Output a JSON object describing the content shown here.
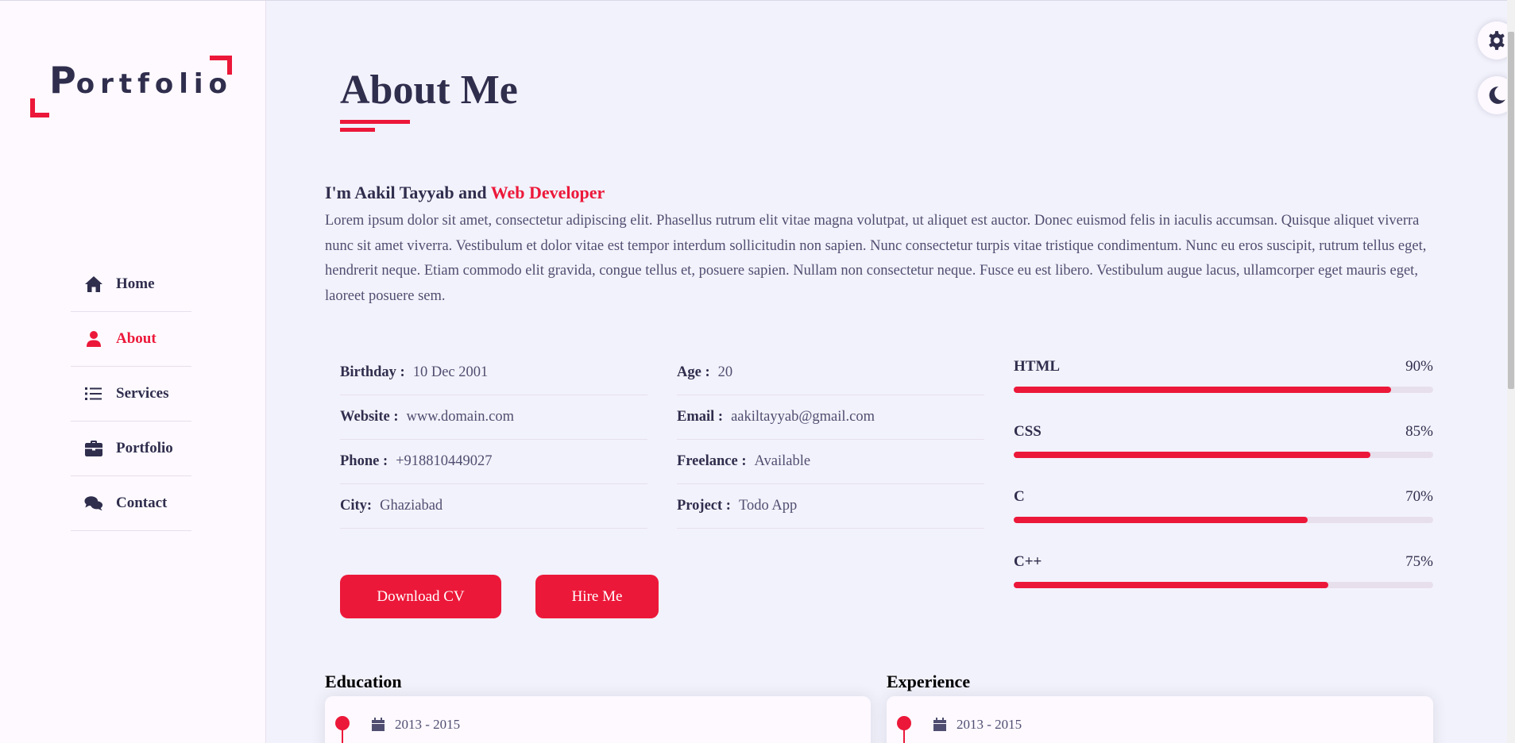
{
  "logo": {
    "first_letter": "P",
    "rest": "ortfolio"
  },
  "nav": {
    "items": [
      {
        "label": "Home",
        "icon": "home-icon",
        "active": false
      },
      {
        "label": "About",
        "icon": "user-icon",
        "active": true
      },
      {
        "label": "Services",
        "icon": "list-icon",
        "active": false
      },
      {
        "label": "Portfolio",
        "icon": "briefcase-icon",
        "active": false
      },
      {
        "label": "Contact",
        "icon": "comments-icon",
        "active": false
      }
    ]
  },
  "about": {
    "title": "About Me",
    "intro_prefix": "I'm Aakil Tayyab and ",
    "intro_role": "Web Developer",
    "intro_text": "Lorem ipsum dolor sit amet, consectetur adipiscing elit. Phasellus rutrum elit vitae magna volutpat, ut aliquet est auctor. Donec euismod felis in iaculis accumsan. Quisque aliquet viverra nunc sit amet viverra. Vestibulum et dolor vitae est tempor interdum sollicitudin non sapien. Nunc consectetur turpis vitae tristique condimentum. Nunc eu eros suscipit, rutrum tellus eget, hendrerit neque. Etiam commodo elit gravida, congue tellus et, posuere sapien. Nullam non consectetur neque. Fusce eu est libero. Vestibulum augue lacus, ullamcorper eget mauris eget, laoreet posuere sem.",
    "info_left": [
      {
        "key": "Birthday :",
        "value": "10 Dec 2001"
      },
      {
        "key": "Website :",
        "value": "www.domain.com"
      },
      {
        "key": "Phone :",
        "value": "+918810449027"
      },
      {
        "key": "City:",
        "value": "Ghaziabad"
      }
    ],
    "info_right": [
      {
        "key": "Age :",
        "value": "20"
      },
      {
        "key": "Email :",
        "value": "aakiltayyab@gmail.com"
      },
      {
        "key": "Freelance :",
        "value": "Available"
      },
      {
        "key": "Project :",
        "value": "Todo App"
      }
    ],
    "buttons": {
      "download_cv": "Download CV",
      "hire_me": "Hire Me"
    },
    "skills": [
      {
        "name": "HTML",
        "percent_label": "90%",
        "level": 90
      },
      {
        "name": "CSS",
        "percent_label": "85%",
        "level": 85
      },
      {
        "name": "C",
        "percent_label": "70%",
        "level": 70
      },
      {
        "name": "C++",
        "percent_label": "75%",
        "level": 75
      }
    ],
    "education": {
      "title": "Education",
      "first_date": "2013 - 2015"
    },
    "experience": {
      "title": "Experience",
      "first_date": "2013 - 2015"
    }
  },
  "colors": {
    "accent": "#ec1839",
    "text": "#302e4d",
    "muted": "#504e70",
    "bg": "#f2f2fc",
    "panel": "#fdf9ff"
  },
  "switcher": {
    "gear_icon": "gear-icon",
    "moon_icon": "moon-icon"
  }
}
